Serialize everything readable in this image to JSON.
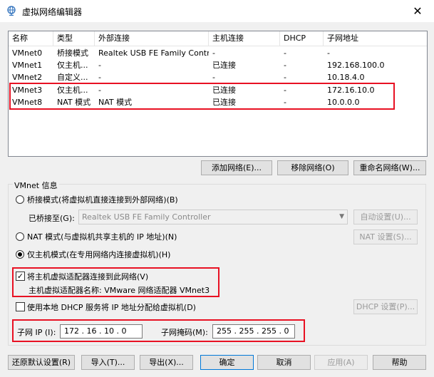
{
  "window": {
    "title": "虚拟网络编辑器",
    "close_glyph": "✕"
  },
  "table": {
    "columns": [
      "名称",
      "类型",
      "外部连接",
      "主机连接",
      "DHCP",
      "子网地址"
    ],
    "rows": [
      [
        "VMnet0",
        "桥接模式",
        "Realtek USB FE Family Contr...",
        "-",
        "-",
        "-"
      ],
      [
        "VMnet1",
        "仅主机...",
        "-",
        "已连接",
        "-",
        "192.168.100.0"
      ],
      [
        "VMnet2",
        "自定义...",
        "-",
        "-",
        "-",
        "10.18.4.0"
      ],
      [
        "VMnet3",
        "仅主机...",
        "-",
        "已连接",
        "-",
        "172.16.10.0"
      ],
      [
        "VMnet8",
        "NAT 模式",
        "NAT 模式",
        "已连接",
        "-",
        "10.0.0.0"
      ]
    ]
  },
  "net_buttons": {
    "add": "添加网络(E)...",
    "remove": "移除网络(O)",
    "rename": "重命名网络(W)..."
  },
  "vmnet_info": {
    "label": "VMnet 信息",
    "bridge_mode": "桥接模式(将虚拟机直接连接到外部网络)(B)",
    "bridged_to_label": "已桥接至(G):",
    "bridged_to_value": "Realtek USB FE Family Controller",
    "auto_settings": "自动设置(U)...",
    "nat_mode": "NAT 模式(与虚拟机共享主机的 IP 地址)(N)",
    "nat_settings": "NAT 设置(S)...",
    "host_only_mode": "仅主机模式(在专用网络内连接虚拟机)(H)",
    "connect_adapter": "将主机虚拟适配器连接到此网络(V)",
    "adapter_name": "主机虚拟适配器名称: VMware 网络适配器 VMnet3",
    "use_dhcp": "使用本地 DHCP 服务将 IP 地址分配给虚拟机(D)",
    "dhcp_settings": "DHCP 设置(P)...",
    "subnet_ip_label": "子网 IP (I):",
    "subnet_ip": "172 . 16 . 10 . 0",
    "subnet_mask_label": "子网掩码(M):",
    "subnet_mask": "255 . 255 . 255 . 0",
    "checkmark": "✓"
  },
  "footer": {
    "restore": "还原默认设置(R)",
    "import": "导入(T)...",
    "export": "导出(X)...",
    "ok": "确定",
    "cancel": "取消",
    "apply": "应用(A)",
    "help": "帮助"
  },
  "colors": {
    "highlight": "#e81123",
    "window_bg": "#f0f0f0"
  }
}
